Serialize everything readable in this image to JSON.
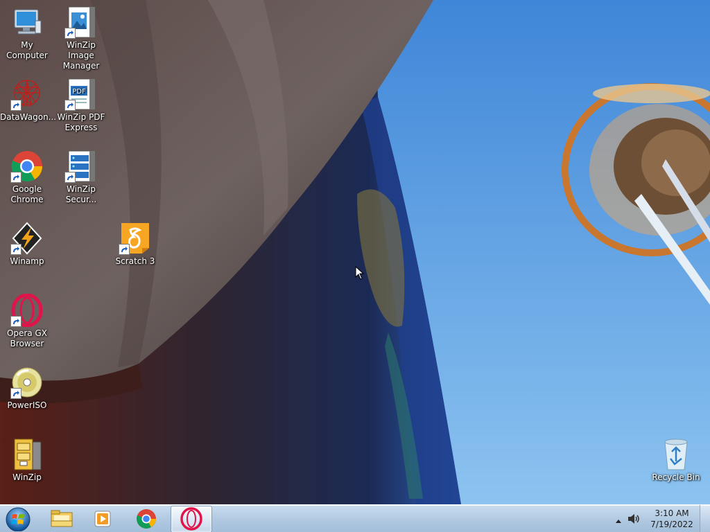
{
  "desktop": {
    "icons": {
      "my_computer": "My Computer",
      "winzip_image_manager": "WinZip Image Manager",
      "datawagon": "DataWagon...",
      "winzip_pdf_express": "WinZip PDF Express",
      "google_chrome": "Google Chrome",
      "winzip_secure": "WinZip Secur...",
      "winamp": "Winamp",
      "scratch3": "Scratch 3",
      "opera_gx": "Opera GX Browser",
      "poweriso": "PowerISO",
      "winzip": "WinZip",
      "recycle_bin": "Recycle Bin"
    }
  },
  "taskbar": {
    "start_icon": "windows-orb-icon",
    "pinned": [
      "file-explorer-icon",
      "media-player-icon",
      "chrome-icon",
      "opera-gx-icon"
    ],
    "active": "opera-gx-icon"
  },
  "tray": {
    "time": "3:10 AM",
    "date": "7/19/2022",
    "icons": [
      "show-hidden-icons-arrow-icon",
      "volume-icon"
    ]
  }
}
